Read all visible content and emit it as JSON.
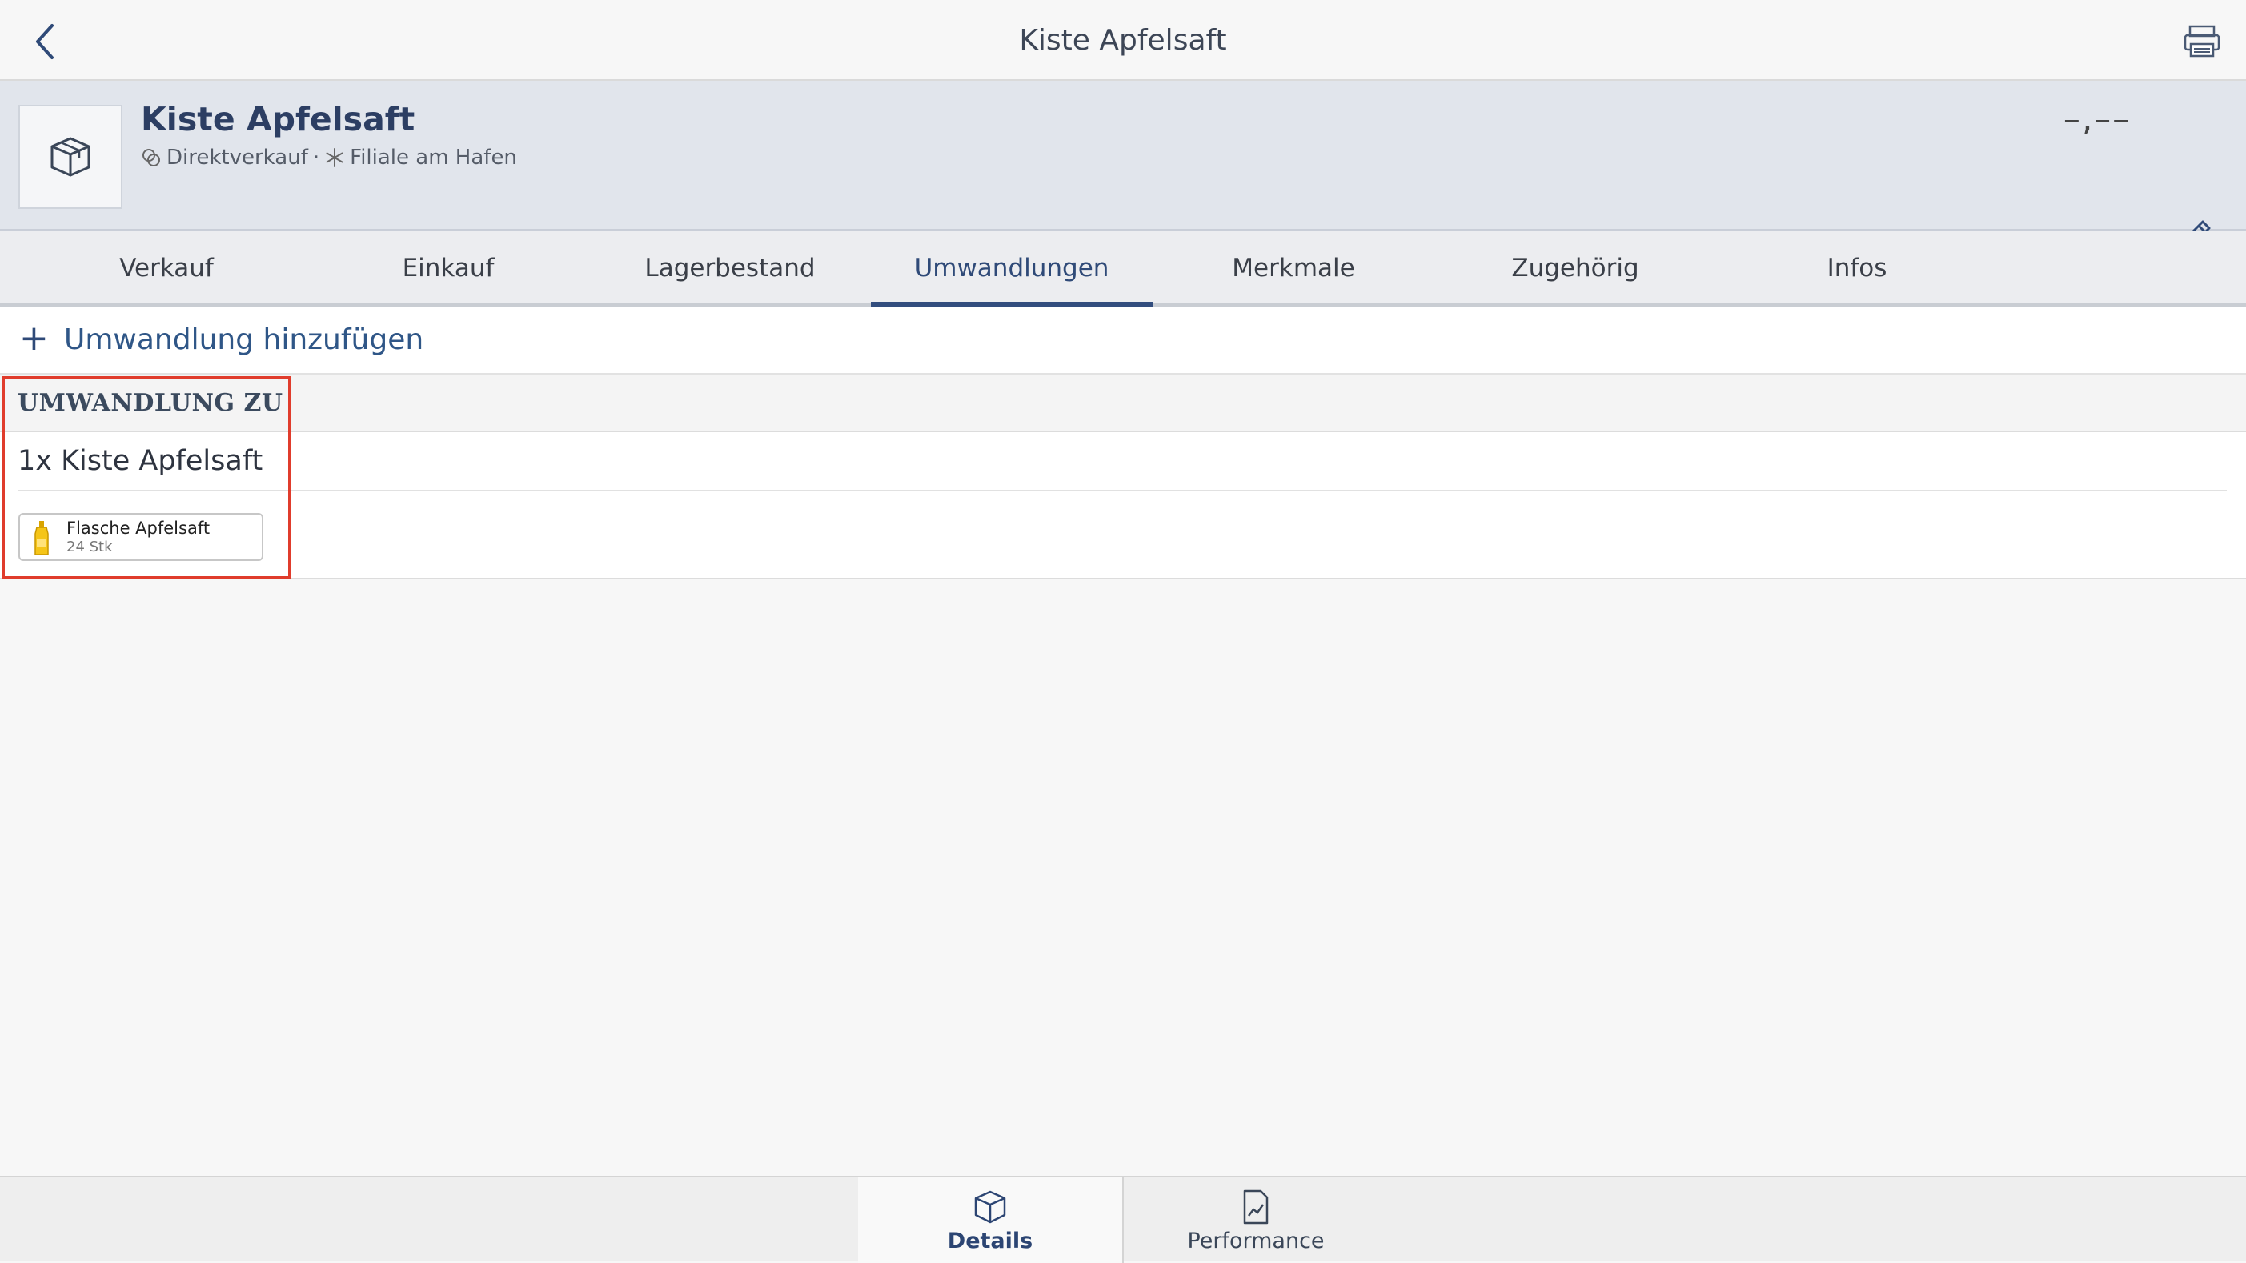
{
  "topbar": {
    "title": "Kiste Apfelsaft",
    "back_icon": "chevron-left-icon",
    "printer_icon": "printer-icon"
  },
  "product": {
    "name": "Kiste Apfelsaft",
    "sale_type": "Direktverkauf",
    "separator": "·",
    "branch": "Filiale am Hafen",
    "price": "–,––",
    "thumbnail_icon": "box-icon",
    "edit_icon": "pencil-icon"
  },
  "tabs": [
    {
      "label": "Verkauf"
    },
    {
      "label": "Einkauf"
    },
    {
      "label": "Lagerbestand"
    },
    {
      "label": "Umwandlungen",
      "active": true
    },
    {
      "label": "Merkmale"
    },
    {
      "label": "Zugehörig"
    },
    {
      "label": "Infos"
    }
  ],
  "add_conversion": {
    "plus": "+",
    "label": "Umwandlung hinzufügen"
  },
  "conversion": {
    "header": "UMWANDLUNG ZU",
    "quantity_title": "1x Kiste Apfelsaft",
    "chip": {
      "name": "Flasche Apfelsaft",
      "qty": "24 Stk"
    }
  },
  "bottom_tabs": [
    {
      "label": "Details",
      "icon": "box-icon",
      "active": true
    },
    {
      "label": "Performance",
      "icon": "chart-document-icon"
    }
  ],
  "colors": {
    "accent": "#324d7e",
    "highlight": "#e03c2c",
    "header_bg": "#e1e5ec"
  }
}
